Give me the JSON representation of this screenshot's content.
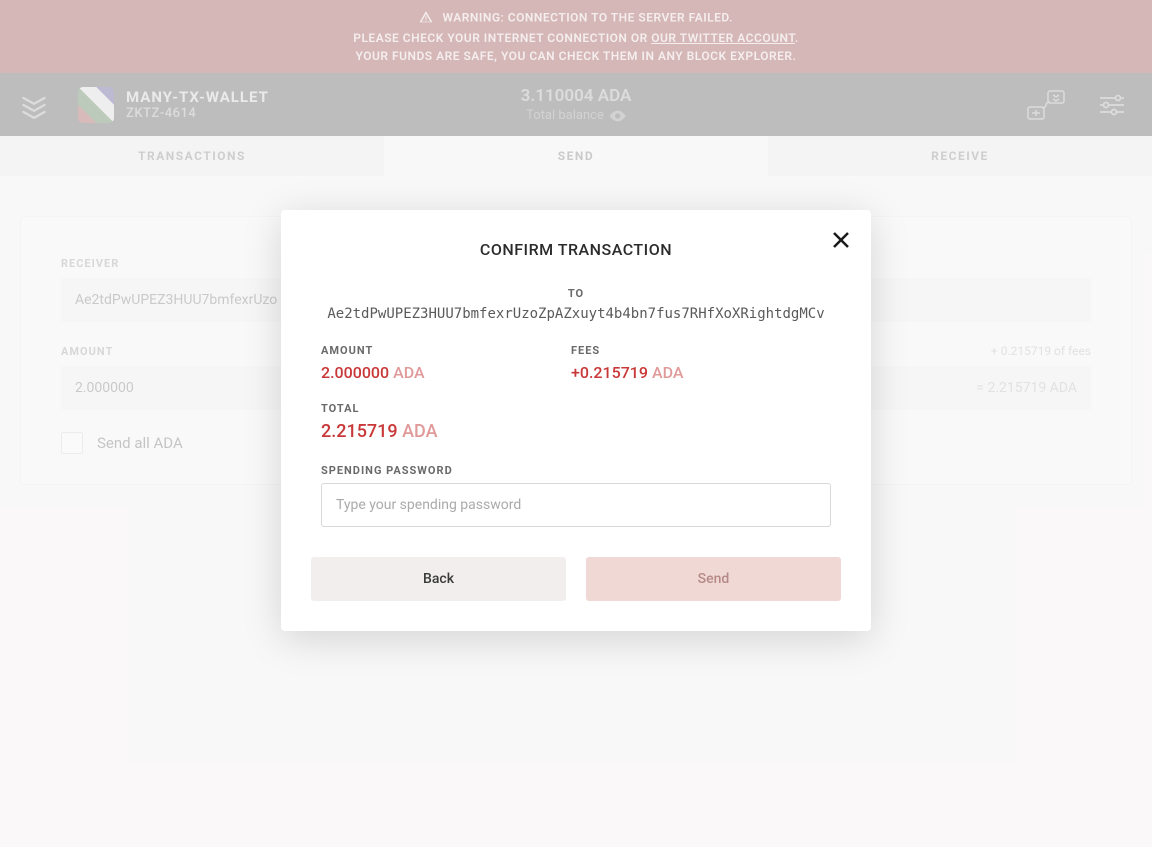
{
  "warning": {
    "line1_prefix": "WARNING: CONNECTION TO THE SERVER FAILED.",
    "line2_prefix": "PLEASE CHECK YOUR INTERNET CONNECTION OR ",
    "line2_link": "OUR TWITTER ACCOUNT",
    "line2_suffix": ".",
    "line3": "YOUR FUNDS ARE SAFE, YOU CAN CHECK THEM IN ANY BLOCK EXPLORER."
  },
  "topbar": {
    "wallet_name": "MANY-TX-WALLET",
    "wallet_sub": "ZKTZ-4614",
    "balance_amount": "3.110004 ADA",
    "balance_label": "Total balance"
  },
  "tabs": {
    "transactions": "TRANSACTIONS",
    "send": "SEND",
    "receive": "RECEIVE"
  },
  "form": {
    "receiver_label": "RECEIVER",
    "receiver_value": "Ae2tdPwUPEZ3HUU7bmfexrUzo",
    "amount_label": "AMOUNT",
    "amount_value": "2.000000",
    "fees_hint": "+ 0.215719 of fees",
    "total_hint": "= 2.215719 ADA",
    "send_all_label": "Send all ADA"
  },
  "modal": {
    "title": "CONFIRM TRANSACTION",
    "to_label": "TO",
    "to_address": "Ae2tdPwUPEZ3HUU7bmfexrUzoZpAZxuyt4b4bn7fus7RHfXoXRightdgMCv",
    "amount_label": "AMOUNT",
    "amount_num": "2.000000",
    "amount_cur": "ADA",
    "fees_label": "FEES",
    "fees_num": "+0.215719",
    "fees_cur": "ADA",
    "total_label": "TOTAL",
    "total_num": "2.215719",
    "total_cur": "ADA",
    "password_label": "SPENDING PASSWORD",
    "password_placeholder": "Type your spending password",
    "back_label": "Back",
    "send_label": "Send"
  }
}
